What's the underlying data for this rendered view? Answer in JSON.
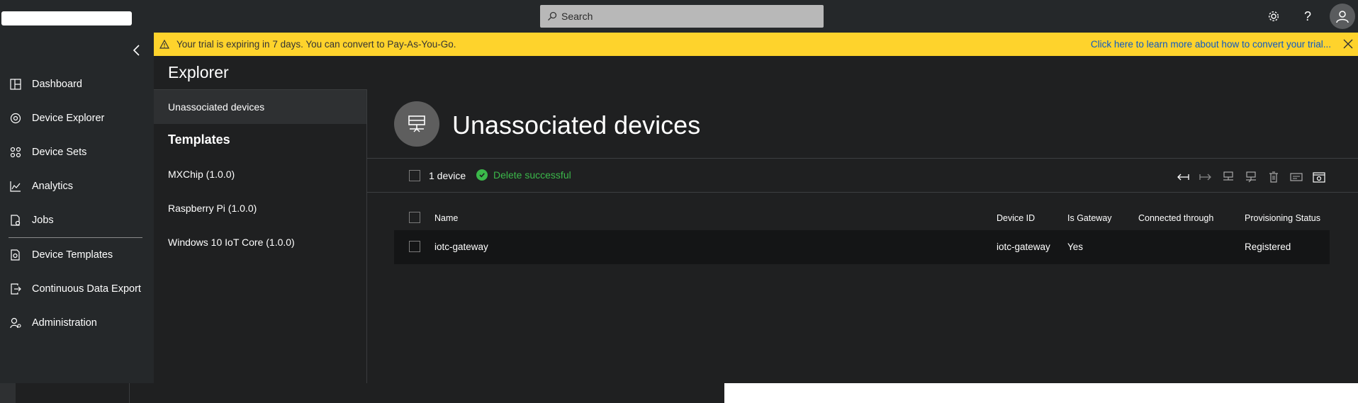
{
  "topbar": {
    "search_placeholder": "Search"
  },
  "banner": {
    "message": "Your trial is expiring in 7 days. You can convert to Pay-As-You-Go.",
    "link": "Click here to learn more about how to convert your trial..."
  },
  "sidebar": {
    "items": [
      {
        "label": "Dashboard",
        "icon": "dashboard-icon"
      },
      {
        "label": "Device Explorer",
        "icon": "device-explorer-icon"
      },
      {
        "label": "Device Sets",
        "icon": "device-sets-icon"
      },
      {
        "label": "Analytics",
        "icon": "analytics-icon"
      },
      {
        "label": "Jobs",
        "icon": "jobs-icon"
      },
      {
        "label": "Device Templates",
        "icon": "device-templates-icon"
      },
      {
        "label": "Continuous Data Export",
        "icon": "data-export-icon"
      },
      {
        "label": "Administration",
        "icon": "administration-icon"
      }
    ]
  },
  "explorer": {
    "title": "Explorer",
    "unassociated_label": "Unassociated devices",
    "templates_heading": "Templates",
    "templates": [
      "MXChip (1.0.0)",
      "Raspberry Pi (1.0.0)",
      "Windows 10 IoT Core (1.0.0)"
    ]
  },
  "main": {
    "title": "Unassociated devices",
    "device_count": "1 device",
    "status_message": "Delete successful",
    "columns": [
      "Name",
      "Device ID",
      "Is Gateway",
      "Connected through",
      "Provisioning Status"
    ],
    "rows": [
      {
        "name": "iotc-gateway",
        "device_id": "iotc-gateway",
        "is_gateway": "Yes",
        "connected_through": "",
        "provisioning_status": "Registered"
      }
    ]
  },
  "colors": {
    "banner": "#fed32c",
    "success": "#3bb84a",
    "link": "#0b58c5"
  }
}
